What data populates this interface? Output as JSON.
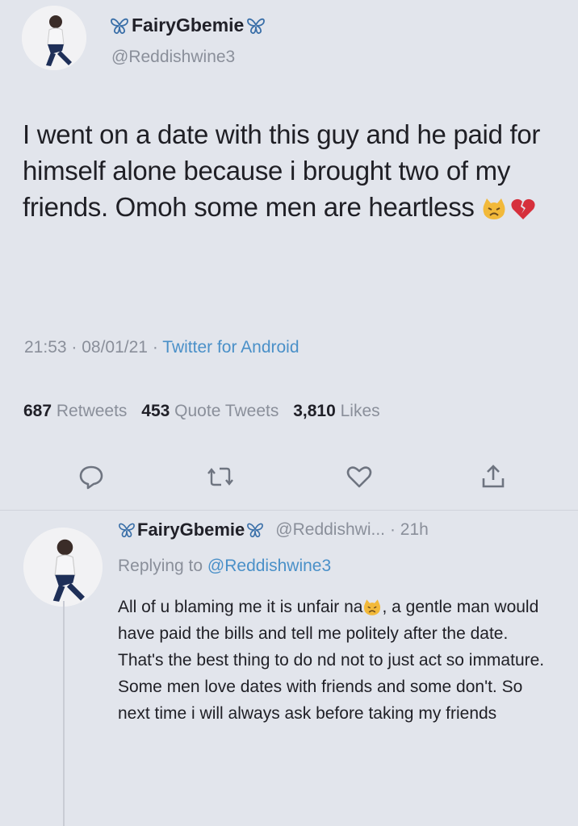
{
  "tweet": {
    "display_name": "FairyGbemie",
    "handle": "@Reddishwine3",
    "text_before_emoji": "I went on a date with this guy and he paid for himself alone because i brought two of my friends. Omoh some men are heartless ",
    "emojis": [
      "weary-cat-face",
      "broken-heart"
    ],
    "time": "21:53",
    "date": "08/01/21",
    "source": "Twitter for Android",
    "separator": " · "
  },
  "stats": {
    "retweets_count": "687",
    "retweets_label": "Retweets",
    "quote_count": "453",
    "quote_label": "Quote Tweets",
    "likes_count": "3,810",
    "likes_label": "Likes"
  },
  "actions": [
    "reply-icon",
    "retweet-icon",
    "like-icon",
    "share-icon"
  ],
  "reply": {
    "display_name": "FairyGbemie",
    "handle": "@Reddishwi...",
    "age": "· 21h",
    "replying_prefix": "Replying to",
    "replying_to": "@Reddishwine3",
    "text_part1": "All of u blaming me it is unfair na",
    "text_part2": ", a gentle man would have paid the bills and tell me politely after the date. That's the best thing to do nd not to just act so immature.",
    "text_part3": "Some men love dates with friends and some don't. So next time i will always ask before taking my friends"
  },
  "colors": {
    "background": "#e2e5ec",
    "link": "#4a90c8",
    "muted": "#8a8f9a",
    "butterfly": "#3a6fa8"
  }
}
